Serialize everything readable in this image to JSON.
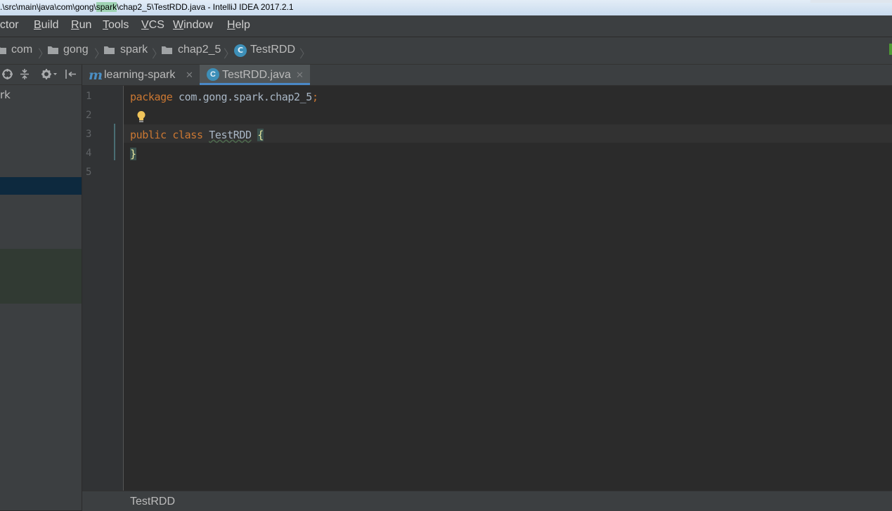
{
  "window": {
    "title_prefix": ".\\src\\main\\java\\com\\gong\\",
    "title_highlight": "spark",
    "title_suffix": "\\chap2_5\\TestRDD.java - IntelliJ IDEA 2017.2.1"
  },
  "menu": {
    "items": [
      {
        "label": "actor",
        "underline": "a",
        "rest": "ctor"
      },
      {
        "label": "Build",
        "underline": "B",
        "rest": "uild"
      },
      {
        "label": "Run",
        "underline": "R",
        "rest": "un"
      },
      {
        "label": "Tools",
        "underline": "T",
        "rest": "ools"
      },
      {
        "label": "VCS",
        "underline": "V",
        "rest": "CS"
      },
      {
        "label": "Window",
        "underline": "W",
        "rest": "indow"
      },
      {
        "label": "Help",
        "underline": "H",
        "rest": "elp"
      }
    ]
  },
  "breadcrumb": {
    "items": [
      "com",
      "gong",
      "spark",
      "chap2_5",
      "TestRDD"
    ],
    "class_icon": "C"
  },
  "project_panel": {
    "tree_text": "rk"
  },
  "tabs": [
    {
      "label": "learning-spark",
      "icon": "m",
      "active": false
    },
    {
      "label": "TestRDD.java",
      "icon": "C",
      "active": true
    }
  ],
  "editor": {
    "line_numbers": [
      "1",
      "2",
      "3",
      "4",
      "5"
    ],
    "code": {
      "line1_kw": "package",
      "line1_pkg": " com.gong.spark.chap2_5",
      "line1_semi": ";",
      "line3_kw": "public class ",
      "line3_cls": "TestRDD",
      "line3_brace": "{",
      "line4_brace": "}"
    }
  },
  "status": {
    "bottom_breadcrumb": "TestRDD"
  },
  "colors": {
    "accent": "#4a88c7",
    "keyword": "#cc7832",
    "class_icon": "#3d8fb8"
  }
}
